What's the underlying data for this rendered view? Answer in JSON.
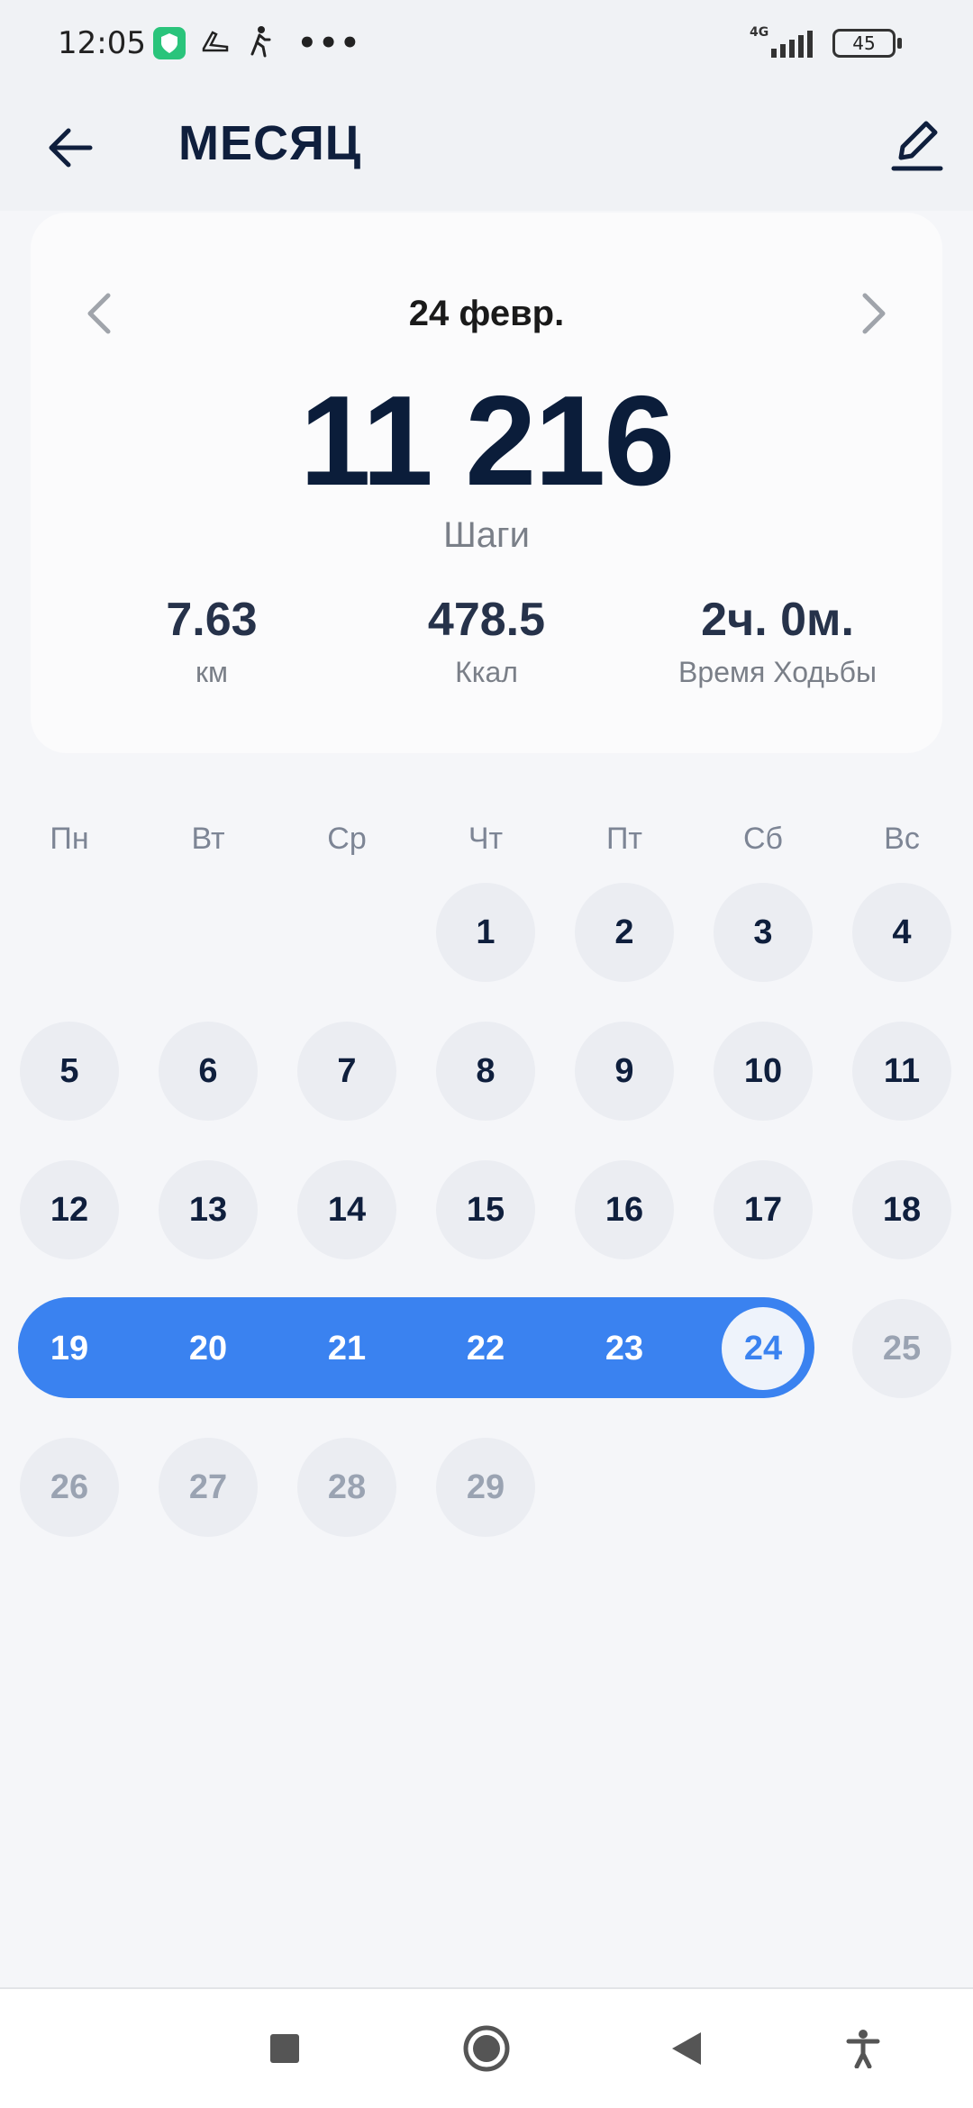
{
  "status_bar": {
    "time": "12:05",
    "network": "4G",
    "battery": "45",
    "icons": [
      "shield-icon",
      "shoe-icon",
      "walking-icon",
      "more-dots-icon",
      "signal-icon",
      "battery-icon"
    ]
  },
  "app_bar": {
    "title": "МЕСЯЦ",
    "back_icon": "arrow-left-icon",
    "edit_icon": "pencil-icon"
  },
  "summary": {
    "date": "24 февр.",
    "steps": "11 216",
    "steps_label": "Шаги",
    "stats": [
      {
        "value": "7.63",
        "label": "км"
      },
      {
        "value": "478.5",
        "label": "Ккал"
      },
      {
        "value": "2ч. 0м.",
        "label": "Время Ходьбы"
      }
    ]
  },
  "calendar": {
    "weekdays": [
      "Пн",
      "Вт",
      "Ср",
      "Чт",
      "Пт",
      "Сб",
      "Вс"
    ],
    "days": [
      "1",
      "2",
      "3",
      "4",
      "5",
      "6",
      "7",
      "8",
      "9",
      "10",
      "11",
      "12",
      "13",
      "14",
      "15",
      "16",
      "17",
      "18",
      "19",
      "20",
      "21",
      "22",
      "23",
      "24",
      "25",
      "26",
      "27",
      "28",
      "29"
    ],
    "first_weekday_index": 3,
    "selected_day": "24",
    "highlighted_range": [
      "19",
      "24"
    ],
    "future_days": [
      "25",
      "26",
      "27",
      "28",
      "29"
    ]
  },
  "colors": {
    "accent": "#3a82f0",
    "title": "#0f1f3d",
    "background": "#f5f6f9"
  }
}
